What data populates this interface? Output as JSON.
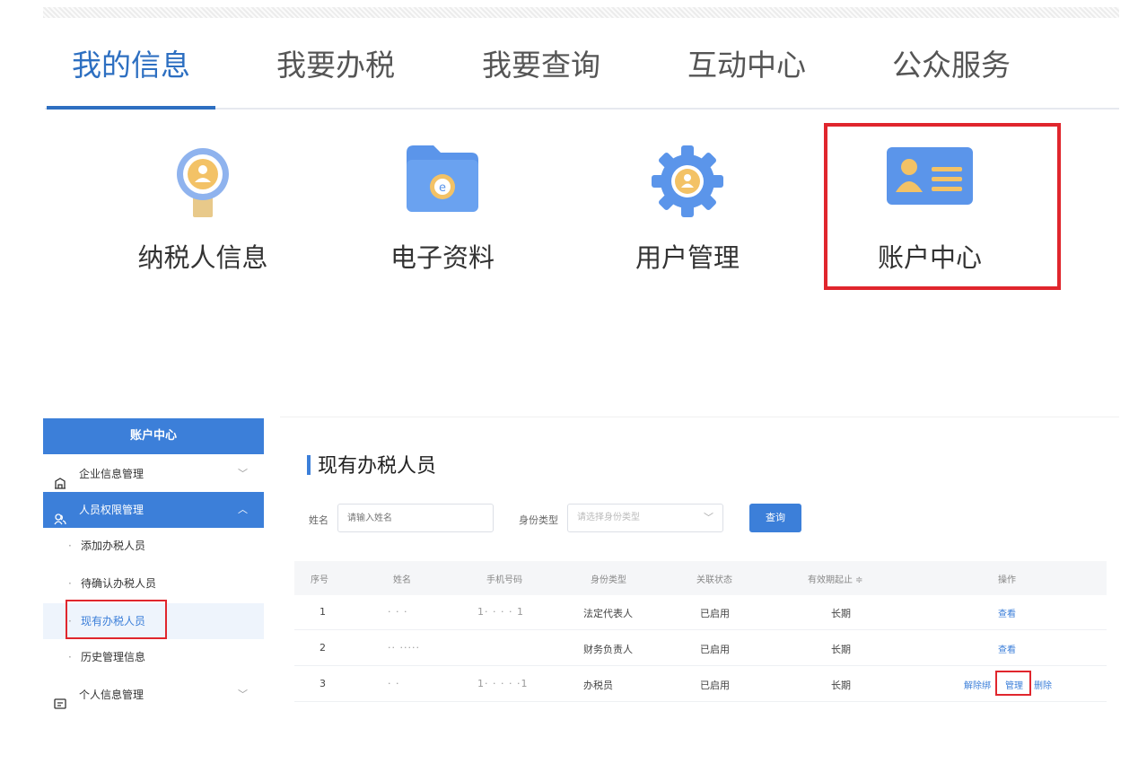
{
  "top_nav": {
    "tabs": [
      {
        "label": "我的信息",
        "active": true
      },
      {
        "label": "我要办税",
        "active": false
      },
      {
        "label": "我要查询",
        "active": false
      },
      {
        "label": "互动中心",
        "active": false
      },
      {
        "label": "公众服务",
        "active": false
      }
    ]
  },
  "tiles": [
    {
      "label": "纳税人信息",
      "icon": "taxpayer-badge-icon"
    },
    {
      "label": "电子资料",
      "icon": "folder-icon"
    },
    {
      "label": "用户管理",
      "icon": "gear-user-icon"
    },
    {
      "label": "账户中心",
      "icon": "id-card-icon",
      "highlighted": true
    }
  ],
  "sidebar": {
    "title": "账户中心",
    "groups": [
      {
        "label": "企业信息管理",
        "icon": "building-icon",
        "expanded": false
      },
      {
        "label": "人员权限管理",
        "icon": "users-icon",
        "expanded": true
      },
      {
        "label": "个人信息管理",
        "icon": "profile-card-icon",
        "expanded": false
      }
    ],
    "sub_items": [
      {
        "label": "添加办税人员"
      },
      {
        "label": "待确认办税人员"
      },
      {
        "label": "现有办税人员",
        "current": true
      },
      {
        "label": "历史管理信息"
      }
    ]
  },
  "main": {
    "title": "现有办税人员",
    "filters": {
      "name_label": "姓名",
      "name_placeholder": "请输入姓名",
      "type_label": "身份类型",
      "type_placeholder": "请选择身份类型",
      "query_button": "查询"
    },
    "table": {
      "headers": [
        "序号",
        "姓名",
        "手机号码",
        "身份类型",
        "关联状态",
        "有效期起止 ≑",
        "操作"
      ],
      "rows": [
        {
          "index": "1",
          "name": "·  ·  ·",
          "phone": "1· ·   ·  ·  1",
          "type": "法定代表人",
          "status": "已启用",
          "validity": "长期",
          "actions": [
            "查看"
          ]
        },
        {
          "index": "2",
          "name": "·· ·····",
          "phone": "",
          "type": "财务负责人",
          "status": "已启用",
          "validity": "长期",
          "actions": [
            "查看"
          ]
        },
        {
          "index": "3",
          "name": "· ·",
          "phone": "1· ·   ·  ·  ·1",
          "type": "办税员",
          "status": "已启用",
          "validity": "长期",
          "actions": [
            "解除绑",
            "管理",
            "删除"
          ]
        }
      ]
    }
  },
  "colors": {
    "accent": "#3c7fd9",
    "nav_active": "#2d6fc1",
    "highlight": "#e0262d"
  }
}
